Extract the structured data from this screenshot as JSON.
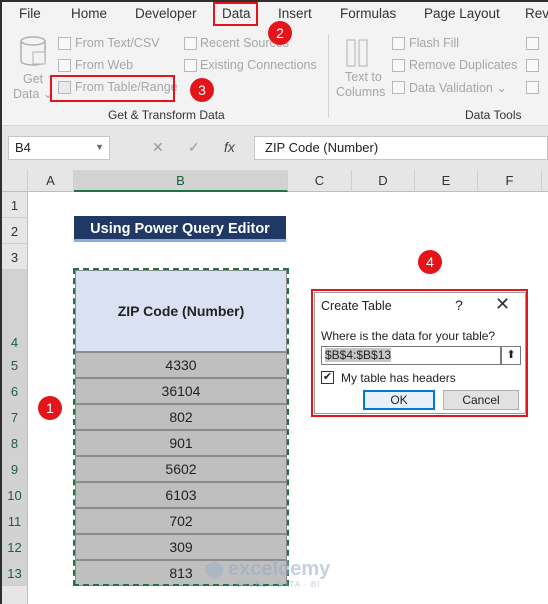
{
  "menu": {
    "tabs": [
      "File",
      "Home",
      "Developer",
      "Data",
      "Insert",
      "Formulas",
      "Page Layout",
      "Rev"
    ]
  },
  "ribbon": {
    "get_data": [
      "Get",
      "Data ⌄"
    ],
    "from_text_csv": "From Text/CSV",
    "from_web": "From Web",
    "from_table_range": "From Table/Range",
    "recent_sources": "Recent Sources",
    "existing_connections": "Existing Connections",
    "group_get_transform": "Get & Transform Data",
    "text_to_columns": [
      "Text to",
      "Columns"
    ],
    "flash_fill": "Flash Fill",
    "remove_duplicates": "Remove Duplicates",
    "data_validation": "Data Validation ⌄",
    "group_data_tools": "Data Tools"
  },
  "formula_bar": {
    "name_box": "B4",
    "fx": "fx",
    "content": "ZIP Code (Number)"
  },
  "columns": [
    "A",
    "B",
    "C",
    "D",
    "E",
    "F"
  ],
  "rows": [
    "1",
    "2",
    "3",
    "4",
    "5",
    "6",
    "7",
    "8",
    "9",
    "10",
    "11",
    "12",
    "13"
  ],
  "sheet": {
    "banner": "Using Power Query Editor",
    "header": "ZIP Code (Number)",
    "values": [
      "4330",
      "36104",
      "802",
      "901",
      "5602",
      "6103",
      "702",
      "309",
      "813"
    ]
  },
  "steps": [
    "1",
    "2",
    "3",
    "4"
  ],
  "dialog": {
    "title": "Create Table",
    "help": "?",
    "question": "Where is the data for your table?",
    "range": "$B$4:$B$13",
    "checkbox_label": "My table has headers",
    "checked": true,
    "ok": "OK",
    "cancel": "Cancel"
  },
  "watermark": {
    "name": "exceldemy",
    "tagline": "EXCEL · DATA · BI"
  },
  "colors": {
    "accent_red": "#e4141b",
    "banner": "#1f3864",
    "header_fill": "#d9e1f2",
    "cell_fill": "#bfbfbf",
    "excel_green": "#217346"
  }
}
